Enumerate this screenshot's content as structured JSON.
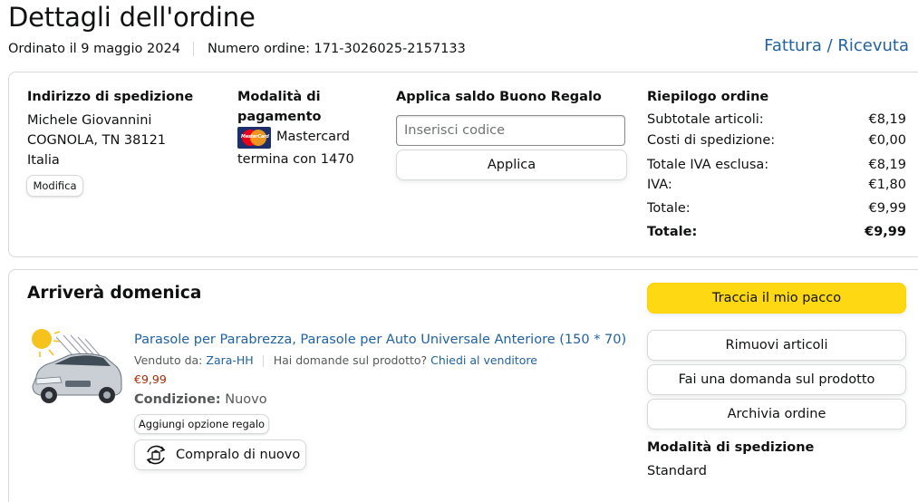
{
  "header": {
    "title": "Dettagli dell'ordine",
    "ordered_on": "Ordinato il 9 maggio 2024",
    "order_number": "Numero ordine: 171-3026025-2157133",
    "invoice_link": "Fattura / Ricevuta"
  },
  "shipping_address": {
    "heading": "Indirizzo di spedizione",
    "name": "Michele Giovannini",
    "city_line": "COGNOLA, TN 38121",
    "country": "Italia",
    "edit_label": "Modifica"
  },
  "payment": {
    "heading_line1": "Modalità di",
    "heading_line2": "pagamento",
    "card_brand": "Mastercard",
    "card_logo_text": "MasterCard",
    "card_ending": "termina con 1470"
  },
  "gift_card": {
    "heading": "Applica saldo Buono Regalo",
    "placeholder": "Inserisci codice",
    "apply_label": "Applica"
  },
  "summary": {
    "heading": "Riepilogo ordine",
    "rows": [
      {
        "label": "Subtotale articoli:",
        "value": "€8,19"
      },
      {
        "label": "Costi di spedizione:",
        "value": "€0,00"
      },
      {
        "label": "Totale IVA esclusa:",
        "value": "€8,19"
      },
      {
        "label": "IVA:",
        "value": "€1,80"
      },
      {
        "label": "Totale:",
        "value": "€9,99"
      }
    ],
    "grand_total_label": "Totale:",
    "grand_total_value": "€9,99"
  },
  "delivery": {
    "heading": "Arriverà domenica",
    "product": {
      "title": "Parasole per Parabrezza, Parasole per Auto Universale Anteriore (150 * 70)",
      "sold_by_label": "Venduto da:",
      "seller": "Zara-HH",
      "question_text": "Hai domande sul prodotto?",
      "ask_seller_link": "Chiedi al venditore",
      "price": "€9,99",
      "condition_label": "Condizione:",
      "condition_value": "Nuovo",
      "gift_option_label": "Aggiungi opzione regalo",
      "buy_again_label": "Compralo di nuovo"
    },
    "actions": {
      "track": "Traccia il mio pacco",
      "remove": "Rimuovi articoli",
      "ask_question": "Fai una domanda sul prodotto",
      "archive": "Archivia ordine"
    },
    "shipping_method_heading": "Modalità di spedizione",
    "shipping_method": "Standard"
  },
  "colors": {
    "link": "#2162a1",
    "price": "#b12704",
    "primary_button": "#ffd814",
    "border": "#d5d9d9"
  }
}
